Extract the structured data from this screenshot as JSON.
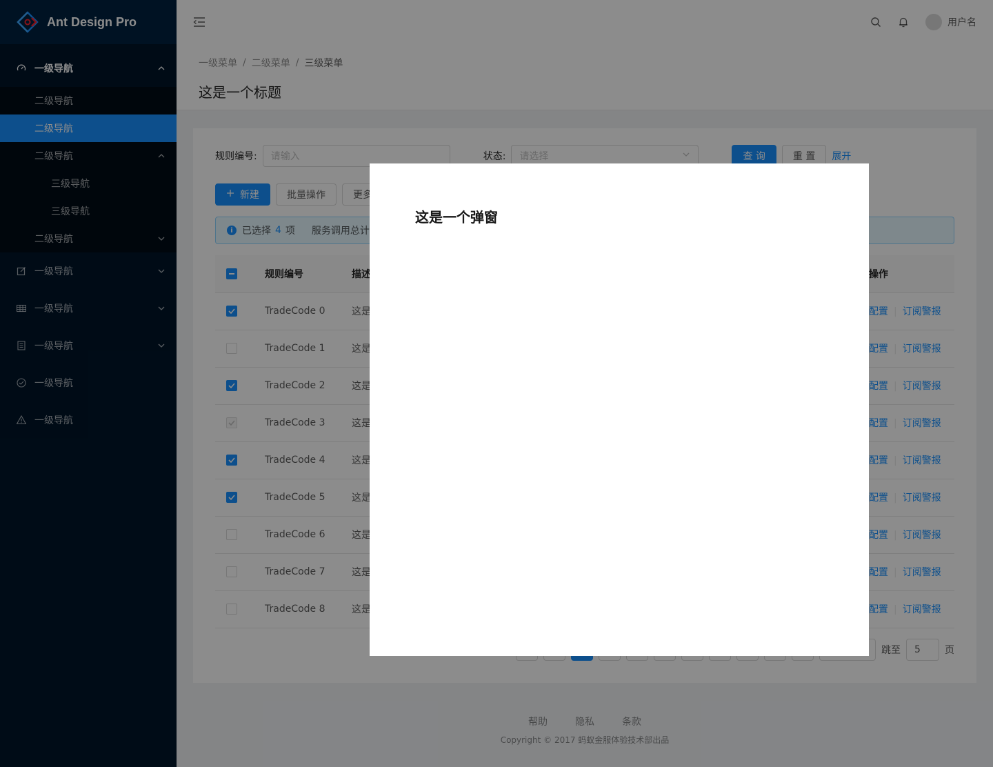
{
  "app": {
    "title": "Ant Design Pro"
  },
  "sidebar": {
    "items": [
      {
        "label": "一级导航",
        "icon": "dashboard-icon",
        "expanded": true
      },
      {
        "label": "二级导航"
      },
      {
        "label": "二级导航",
        "selected": true
      },
      {
        "label": "二级导航",
        "expanded": true
      },
      {
        "label": "三级导航"
      },
      {
        "label": "三级导航"
      },
      {
        "label": "二级导航",
        "expanded": false
      },
      {
        "label": "一级导航",
        "icon": "form-icon"
      },
      {
        "label": "一级导航",
        "icon": "table-icon"
      },
      {
        "label": "一级导航",
        "icon": "profile-icon"
      },
      {
        "label": "一级导航",
        "icon": "check-circle-icon"
      },
      {
        "label": "一级导航",
        "icon": "warning-icon"
      }
    ]
  },
  "header": {
    "username": "用户名"
  },
  "breadcrumb": {
    "item1": "一级菜单",
    "item2": "二级菜单",
    "item3": "三级菜单",
    "separator": "/"
  },
  "page": {
    "title": "这是一个标题"
  },
  "filters": {
    "rule_label": "规则编号:",
    "rule_placeholder": "请输入",
    "status_label": "状态:",
    "status_placeholder": "请选择",
    "query": "查 询",
    "reset": "重 置",
    "expand": "展开"
  },
  "toolbar": {
    "new": "新建",
    "batch": "批量操作",
    "more": "更多"
  },
  "alert": {
    "prefix": "已选择",
    "count": "4",
    "suffix": "项",
    "service_label": "服务调用总计:"
  },
  "table": {
    "headers": {
      "rule": "规则编号",
      "desc": "描述",
      "ops": "操作"
    },
    "rows": [
      {
        "code": "TradeCode 0",
        "desc": "这是",
        "op1": "配置",
        "op2": "订阅警报",
        "checked": "on"
      },
      {
        "code": "TradeCode 1",
        "desc": "这是",
        "op1": "配置",
        "op2": "订阅警报",
        "checked": "off"
      },
      {
        "code": "TradeCode 2",
        "desc": "这是",
        "op1": "配置",
        "op2": "订阅警报",
        "checked": "on"
      },
      {
        "code": "TradeCode 3",
        "desc": "这是",
        "op1": "配置",
        "op2": "订阅警报",
        "checked": "disabled"
      },
      {
        "code": "TradeCode 4",
        "desc": "这是",
        "op1": "配置",
        "op2": "订阅警报",
        "checked": "on"
      },
      {
        "code": "TradeCode 5",
        "desc": "这是",
        "op1": "配置",
        "op2": "订阅警报",
        "checked": "on"
      },
      {
        "code": "TradeCode 6",
        "desc": "这是",
        "op1": "配置",
        "op2": "订阅警报",
        "checked": "off"
      },
      {
        "code": "TradeCode 7",
        "desc": "这是",
        "op1": "配置",
        "op2": "订阅警报",
        "checked": "off"
      },
      {
        "code": "TradeCode 8",
        "desc": "这是",
        "op1": "配置",
        "op2": "订阅警报",
        "checked": "off"
      }
    ]
  },
  "pagination": {
    "jump_label": "跳至",
    "jump_value": "5",
    "page_suffix": "页"
  },
  "footer": {
    "help": "帮助",
    "privacy": "隐私",
    "terms": "条款",
    "copyright": "Copyright © 2017 蚂蚁金服体验技术部出品"
  },
  "modal": {
    "title": "这是一个弹窗"
  },
  "colors": {
    "primary": "#1890ff",
    "sider": "#001529",
    "mask": "rgba(0,0,0,0.45)"
  }
}
